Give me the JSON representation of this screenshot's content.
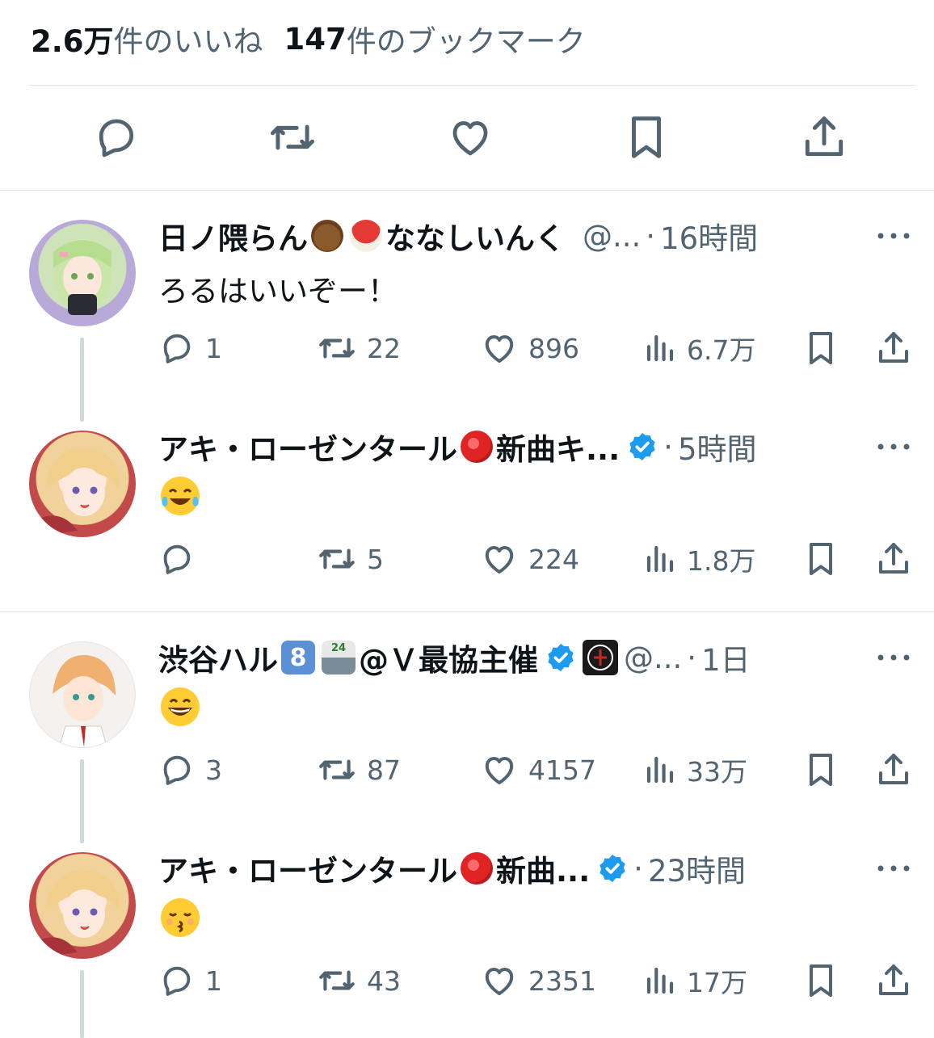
{
  "stats": {
    "likes_value": "2.6万",
    "likes_label": "件のいいね",
    "bookmarks_value": "147",
    "bookmarks_label": "件のブックマーク"
  },
  "colors": {
    "icon": "#536471",
    "text": "#0f1419",
    "verified": "#1d9bf0",
    "divider": "#e1e5e8"
  },
  "replies": [
    {
      "name_a": "日ノ隈らん",
      "name_emoji_1": "bear-emoji",
      "name_emoji_2": "mushroom-emoji",
      "name_b": "ななしいんく",
      "handle": "@...",
      "dot": "·",
      "time": "16時間",
      "text": "ろるはいいぞー！",
      "replies": "1",
      "retweets": "22",
      "likes": "896",
      "views": "6.7万"
    },
    {
      "name_a": "アキ・ローゼンタール",
      "name_emoji_1": "apple-emoji",
      "name_b": "新曲キ...",
      "dot": "·",
      "time": "5時間",
      "text_emoji": "tears-of-joy-emoji",
      "replies": "",
      "retweets": "5",
      "likes": "224",
      "views": "1.8万"
    },
    {
      "name_a": "渋谷ハル",
      "name_b": "@Ｖ最協主催",
      "handle": "@...",
      "dot": "·",
      "time": "1日",
      "badge_8": "8",
      "badge_24": "24",
      "text_emoji": "grinning-emoji",
      "replies": "3",
      "retweets": "87",
      "likes": "4157",
      "views": "33万"
    },
    {
      "name_a": "アキ・ローゼンタール",
      "name_emoji_1": "apple-emoji",
      "name_b": "新曲...",
      "dot": "·",
      "time": "23時間",
      "text_emoji": "kissing-emoji",
      "replies": "1",
      "retweets": "43",
      "likes": "2351",
      "views": "17万"
    }
  ]
}
